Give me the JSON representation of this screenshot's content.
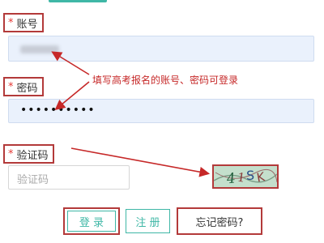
{
  "form": {
    "account": {
      "star": "*",
      "label": "账号"
    },
    "password": {
      "star": "*",
      "label": "密码",
      "value": "••••••••••"
    },
    "captcha": {
      "star": "*",
      "label": "验证码",
      "placeholder": "验证码",
      "image_text": "41SK"
    }
  },
  "annotation": "填写高考报名的账号、密码可登录",
  "buttons": {
    "login": "登 录",
    "register": "注 册",
    "forgot": "忘记密码?"
  },
  "colors": {
    "accent": "#3fb7a6",
    "annotation_red": "#c62828",
    "box_red": "#b33a3a",
    "input_bg": "#eaf1fc"
  }
}
